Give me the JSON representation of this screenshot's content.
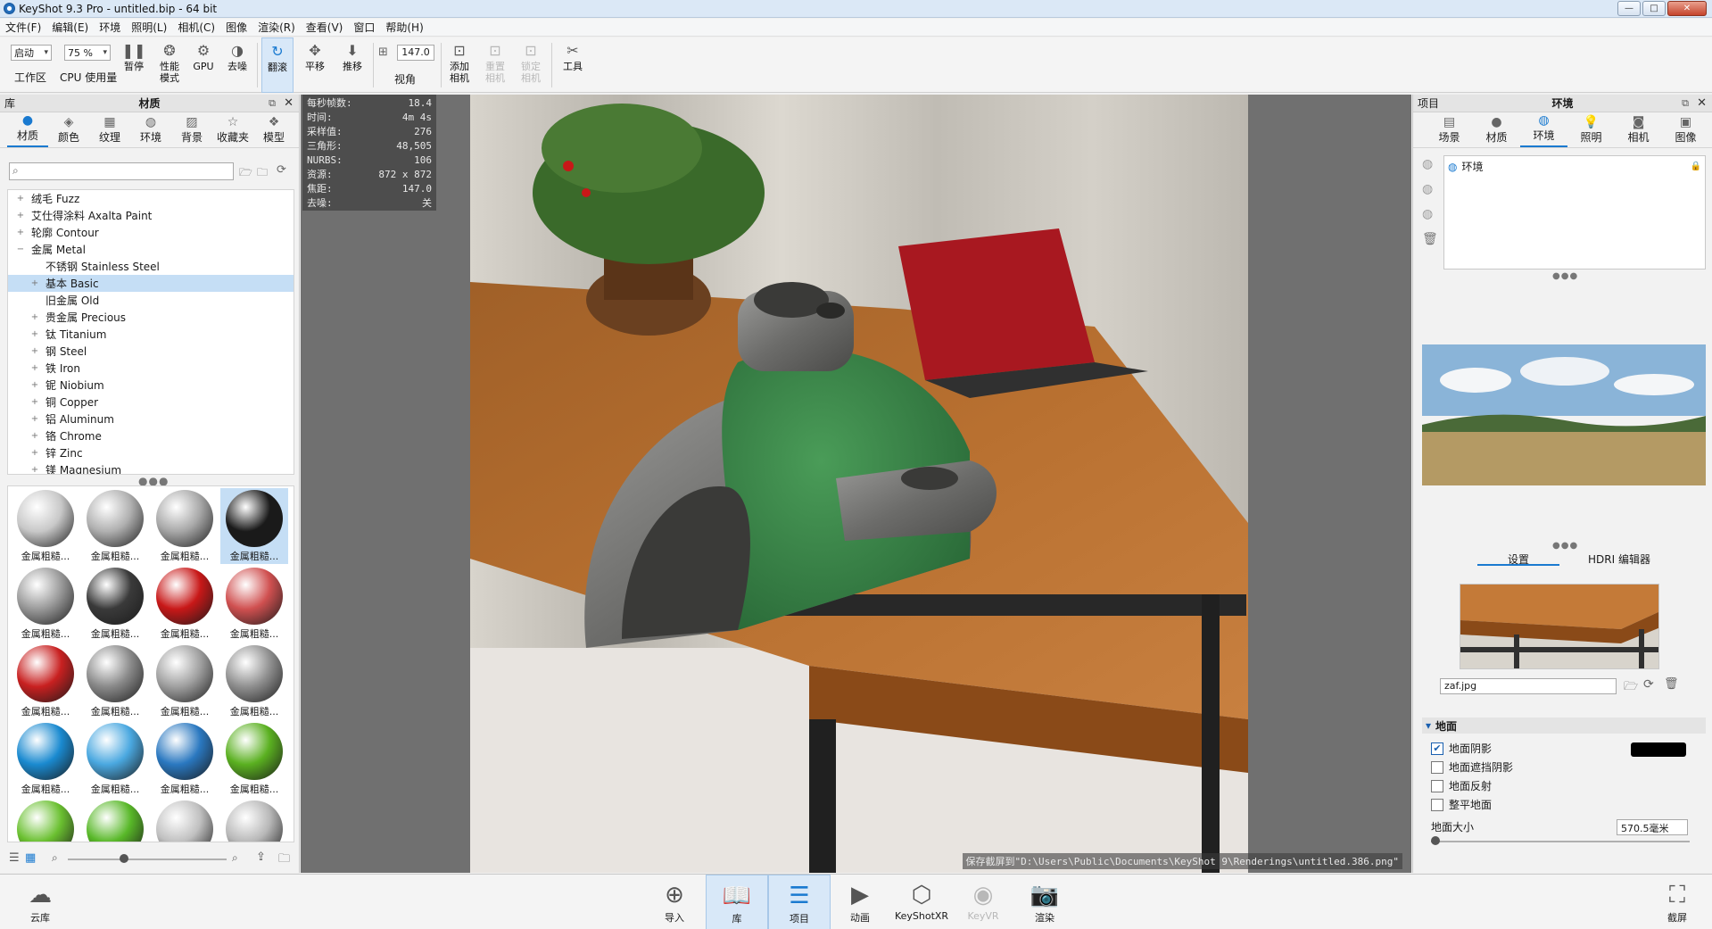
{
  "title": "KeyShot 9.3 Pro  - untitled.bip  - 64 bit",
  "window_buttons": {
    "minimize": "—",
    "maximize": "□",
    "close": "✕"
  },
  "menu": [
    "文件(F)",
    "编辑(E)",
    "环境",
    "照明(L)",
    "相机(C)",
    "图像",
    "渲染(R)",
    "查看(V)",
    "窗口",
    "帮助(H)"
  ],
  "toolbar": {
    "workspace_value": "启动",
    "workspace_label": "工作区",
    "cpu_value": "75 %",
    "cpu_label": "CPU 使用量",
    "pause": "暂停",
    "perf": "性能\n模式",
    "gpu": "GPU",
    "denoise": "去噪",
    "tumble": "翻滚",
    "pan": "平移",
    "dolly": "推移",
    "fov_value": "147.0",
    "fov_label": "视角",
    "add_camera": "添加\n相机",
    "reset_camera": "重置\n相机",
    "lock_camera": "锁定\n相机",
    "tools": "工具"
  },
  "left_panel": {
    "header_left": "库",
    "header_title": "材质",
    "tabs": [
      "材质",
      "颜色",
      "纹理",
      "环境",
      "背景",
      "收藏夹",
      "模型"
    ],
    "search_placeholder": "",
    "tree": [
      {
        "label": "绒毛 Fuzz",
        "level": 0,
        "exp": "+"
      },
      {
        "label": "艾仕得涂料 Axalta Paint",
        "level": 0,
        "exp": "+"
      },
      {
        "label": "轮廓 Contour",
        "level": 0,
        "exp": "+"
      },
      {
        "label": "金属 Metal",
        "level": 0,
        "exp": "−"
      },
      {
        "label": "不锈钢 Stainless Steel",
        "level": 1,
        "exp": ""
      },
      {
        "label": "基本 Basic",
        "level": 1,
        "exp": "+",
        "selected": true
      },
      {
        "label": "旧金属 Old",
        "level": 1,
        "exp": ""
      },
      {
        "label": "贵金属 Precious",
        "level": 1,
        "exp": "+"
      },
      {
        "label": "钛 Titanium",
        "level": 1,
        "exp": "+"
      },
      {
        "label": "钢 Steel",
        "level": 1,
        "exp": "+"
      },
      {
        "label": "铁 Iron",
        "level": 1,
        "exp": "+"
      },
      {
        "label": "铌 Niobium",
        "level": 1,
        "exp": "+"
      },
      {
        "label": "铜 Copper",
        "level": 1,
        "exp": "+"
      },
      {
        "label": "铝 Aluminum",
        "level": 1,
        "exp": "+"
      },
      {
        "label": "铬 Chrome",
        "level": 1,
        "exp": "+"
      },
      {
        "label": "锌 Zinc",
        "level": 1,
        "exp": "+"
      },
      {
        "label": "镁 Magnesium",
        "level": 1,
        "exp": "+"
      }
    ],
    "thumb_label": "金属粗糙...",
    "thumb_colors": [
      "#c8c8c8",
      "#b0b0b0",
      "#a8a8a8",
      "#1a1a1a",
      "#9a9a9a",
      "#3a3a3a",
      "#c81818",
      "#d05050",
      "#c82020",
      "#8a8a8a",
      "#a0a0a0",
      "#909090",
      "#1a8ad0",
      "#4aa8e0",
      "#2a78c0",
      "#5ab020",
      "#6ac030",
      "#58b828",
      "#c0c0c0",
      "#b8b8b8"
    ]
  },
  "hud": [
    {
      "k": "每秒帧数:",
      "v": "18.4"
    },
    {
      "k": "时间:",
      "v": "4m 4s"
    },
    {
      "k": "采样值:",
      "v": "276"
    },
    {
      "k": "三角形:",
      "v": "48,505"
    },
    {
      "k": "NURBS:",
      "v": "106"
    },
    {
      "k": "资源:",
      "v": "872 x 872"
    },
    {
      "k": "焦距:",
      "v": "147.0"
    },
    {
      "k": "去噪:",
      "v": "关"
    }
  ],
  "save_message": "保存截屏到\"D:\\Users\\Public\\Documents\\KeyShot 9\\Renderings\\untitled.386.png\"",
  "right_panel": {
    "header_left": "项目",
    "header_title": "环境",
    "tabs": [
      "场景",
      "材质",
      "环境",
      "照明",
      "相机",
      "图像"
    ],
    "env_item": "环境",
    "sub_tabs": [
      "设置",
      "HDRI 编辑器"
    ],
    "bg_file": "zaf.jpg",
    "ground_section": "地面",
    "ground_shadow": "地面阴影",
    "ground_occlusion": "地面遮挡阴影",
    "ground_reflect": "地面反射",
    "flatten_ground": "整平地面",
    "ground_size_label": "地面大小",
    "ground_size_value": "570.5毫米"
  },
  "bottom": {
    "cloud": "云库",
    "import": "导入",
    "library": "库",
    "project": "项目",
    "animation": "动画",
    "keyshotxr": "KeyShotXR",
    "keyvr": "KeyVR",
    "render": "渲染",
    "screenshot": "截屏"
  }
}
